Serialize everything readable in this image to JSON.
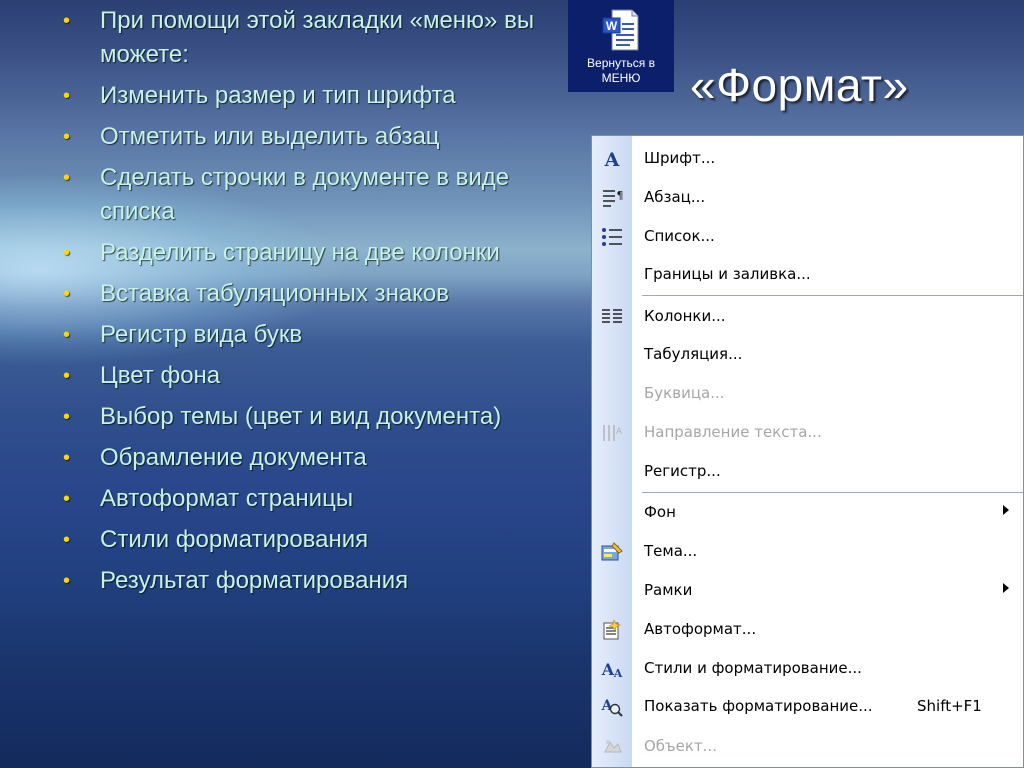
{
  "bullets": [
    "При помощи этой закладки «меню» вы можете:",
    "Изменить размер и тип шрифта",
    "Отметить или выделить абзац",
    "Сделать строчки в документе в виде списка",
    "Разделить страницу на две колонки",
    "Вставка табуляционных знаков",
    "Регистр вида букв",
    "Цвет фона",
    "Выбор темы (цвет и вид документа)",
    "Обрамление документа",
    "Автоформат страницы",
    "Стили форматирования",
    "Результат форматирования"
  ],
  "return_button": {
    "label_line1": "Вернуться в",
    "label_line2": "МЕНЮ",
    "icon": "word-document-icon"
  },
  "title": "«Формат»",
  "menu": {
    "items": [
      {
        "label": "Шрифт...",
        "icon": "font-icon",
        "enabled": true
      },
      {
        "label": "Абзац...",
        "icon": "paragraph-icon",
        "enabled": true
      },
      {
        "label": "Список...",
        "icon": "list-icon",
        "enabled": true
      },
      {
        "label": "Границы и заливка...",
        "icon": "",
        "enabled": true
      },
      {
        "label": "Колонки...",
        "icon": "columns-icon",
        "enabled": true
      },
      {
        "label": "Табуляция...",
        "icon": "",
        "enabled": true
      },
      {
        "label": "Буквица...",
        "icon": "",
        "enabled": false
      },
      {
        "label": "Направление текста...",
        "icon": "text-direction-icon",
        "enabled": false
      },
      {
        "label": "Регистр...",
        "icon": "",
        "enabled": true
      },
      {
        "label": "Фон",
        "icon": "",
        "enabled": true,
        "submenu": true
      },
      {
        "label": "Тема...",
        "icon": "theme-icon",
        "enabled": true
      },
      {
        "label": "Рамки",
        "icon": "",
        "enabled": true,
        "submenu": true
      },
      {
        "label": "Автоформат...",
        "icon": "autoformat-icon",
        "enabled": true
      },
      {
        "label": "Стили и форматирование...",
        "icon": "styles-icon",
        "enabled": true
      },
      {
        "label": "Показать форматирование...",
        "icon": "reveal-formatting-icon",
        "enabled": true,
        "shortcut": "Shift+F1"
      },
      {
        "label": "Объект...",
        "icon": "object-icon",
        "enabled": false
      }
    ]
  },
  "colors": {
    "bullet_text": "#c6f3e6",
    "bullet_dot": "#ffd700",
    "menu_strip": "#c9d9f3",
    "disabled_text": "#a6a6a6"
  }
}
